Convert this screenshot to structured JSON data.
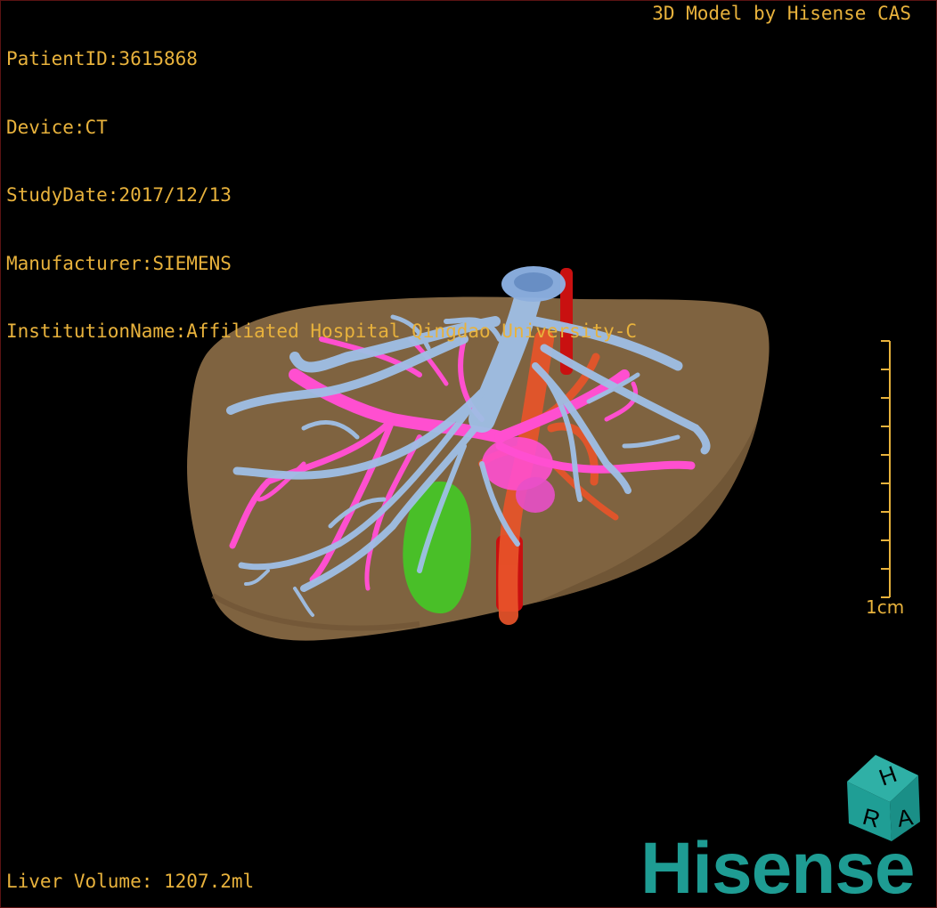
{
  "header": {
    "patient_id": "PatientID:3615868",
    "device": "Device:CT",
    "study_date": "StudyDate:2017/12/13",
    "manufacturer": "Manufacturer:SIEMENS",
    "institution": "InstitutionName:Affiliated Hospital Qingdao University-C"
  },
  "credit": "3D Model by Hisense CAS",
  "footer": {
    "liver_volume": "Liver Volume: 1207.2ml"
  },
  "scale": {
    "label": "1cm"
  },
  "orientation_cube": {
    "faces": [
      "H",
      "R",
      "A"
    ],
    "icon": "orientation-cube-icon"
  },
  "brand": {
    "name": "Hisense"
  },
  "colors": {
    "text": "#e8b23c",
    "liver": "#8a6b45",
    "hepatic_vein": "#9fbfe6",
    "portal_vein": "#ff4fd0",
    "artery": "#e8542a",
    "ivc": "#c91010",
    "gallbladder": "#3fcf25",
    "brand": "#1e9c93"
  }
}
